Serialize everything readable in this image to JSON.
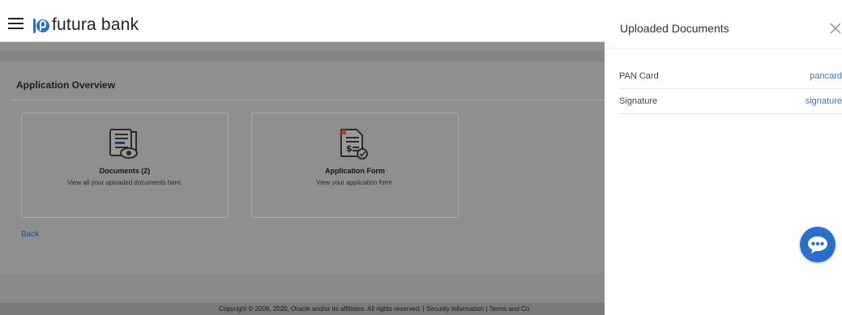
{
  "header": {
    "brand": "futura bank"
  },
  "main": {
    "section_title": "Application Overview",
    "cards": [
      {
        "title": "Documents (2)",
        "description": "View all your uploaded documents here.",
        "icon": "document-view-icon"
      },
      {
        "title": "Application Form",
        "description": "View your application form.",
        "icon": "application-form-icon"
      }
    ],
    "back_label": "Back"
  },
  "footer": {
    "text": "Copyright © 2006, 2020, Oracle and/or its affiliates. All rights reserved. | Security Information | Terms and Co"
  },
  "side_panel": {
    "title": "Uploaded Documents",
    "documents": [
      {
        "label": "PAN Card",
        "link": "pancard"
      },
      {
        "label": "Signature",
        "link": "signature"
      }
    ]
  },
  "colors": {
    "overlay_gray": "#8f8f8f",
    "link_blue": "#3a78c4",
    "chat_blue": "#2a6fc9"
  },
  "icons": [
    "menu-icon",
    "futura-logo-icon",
    "close-icon",
    "chat-icon"
  ]
}
